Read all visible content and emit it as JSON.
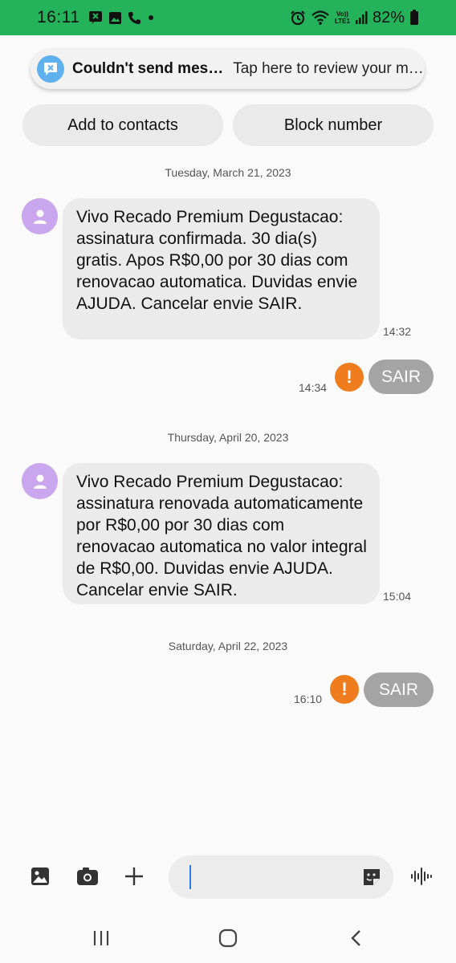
{
  "status_bar": {
    "time": "16:11",
    "battery": "82%",
    "volte_line1": "Vo))",
    "volte_line2": "LTE1"
  },
  "notification": {
    "title": "Couldn't send mes…",
    "body": "Tap here to review your m…"
  },
  "actions": {
    "add_contact": "Add to contacts",
    "block": "Block number"
  },
  "messages": [
    {
      "date": "Tuesday, March 21, 2023"
    },
    {
      "text": "Vivo Recado Premium Degustacao: assinatura confirmada. 30 dia(s) gratis. Apos R$0,00 por 30 dias com renovacao automatica. Duvidas envie AJUDA. Cancelar envie SAIR.",
      "time": "14:32"
    },
    {
      "text": "SAIR",
      "time": "14:34"
    },
    {
      "date": "Thursday, April 20, 2023"
    },
    {
      "text": "Vivo Recado Premium Degustacao: assinatura renovada automaticamente por R$0,00 por 30 dias com renovacao automatica no valor integral de  R$0,00. Duvidas envie AJUDA. Cancelar envie SAIR.",
      "time": "15:04"
    },
    {
      "date": "Saturday, April 22, 2023"
    },
    {
      "text": "SAIR",
      "time": "16:10"
    }
  ],
  "error_glyph": "!",
  "colors": {
    "status_bar": "#24b35a",
    "incoming_bubble": "#ebebeb",
    "outgoing_bubble": "#a4a4a4",
    "error_badge": "#f07d1d",
    "avatar": "#c9a6ee",
    "notification_icon": "#5fb0ee",
    "caret": "#2a7de1"
  },
  "icons": {
    "composer": [
      "gallery-icon",
      "camera-icon",
      "plus-icon",
      "sticker-icon",
      "voice-icon"
    ],
    "nav": [
      "recent-apps-icon",
      "home-icon",
      "back-icon"
    ]
  }
}
